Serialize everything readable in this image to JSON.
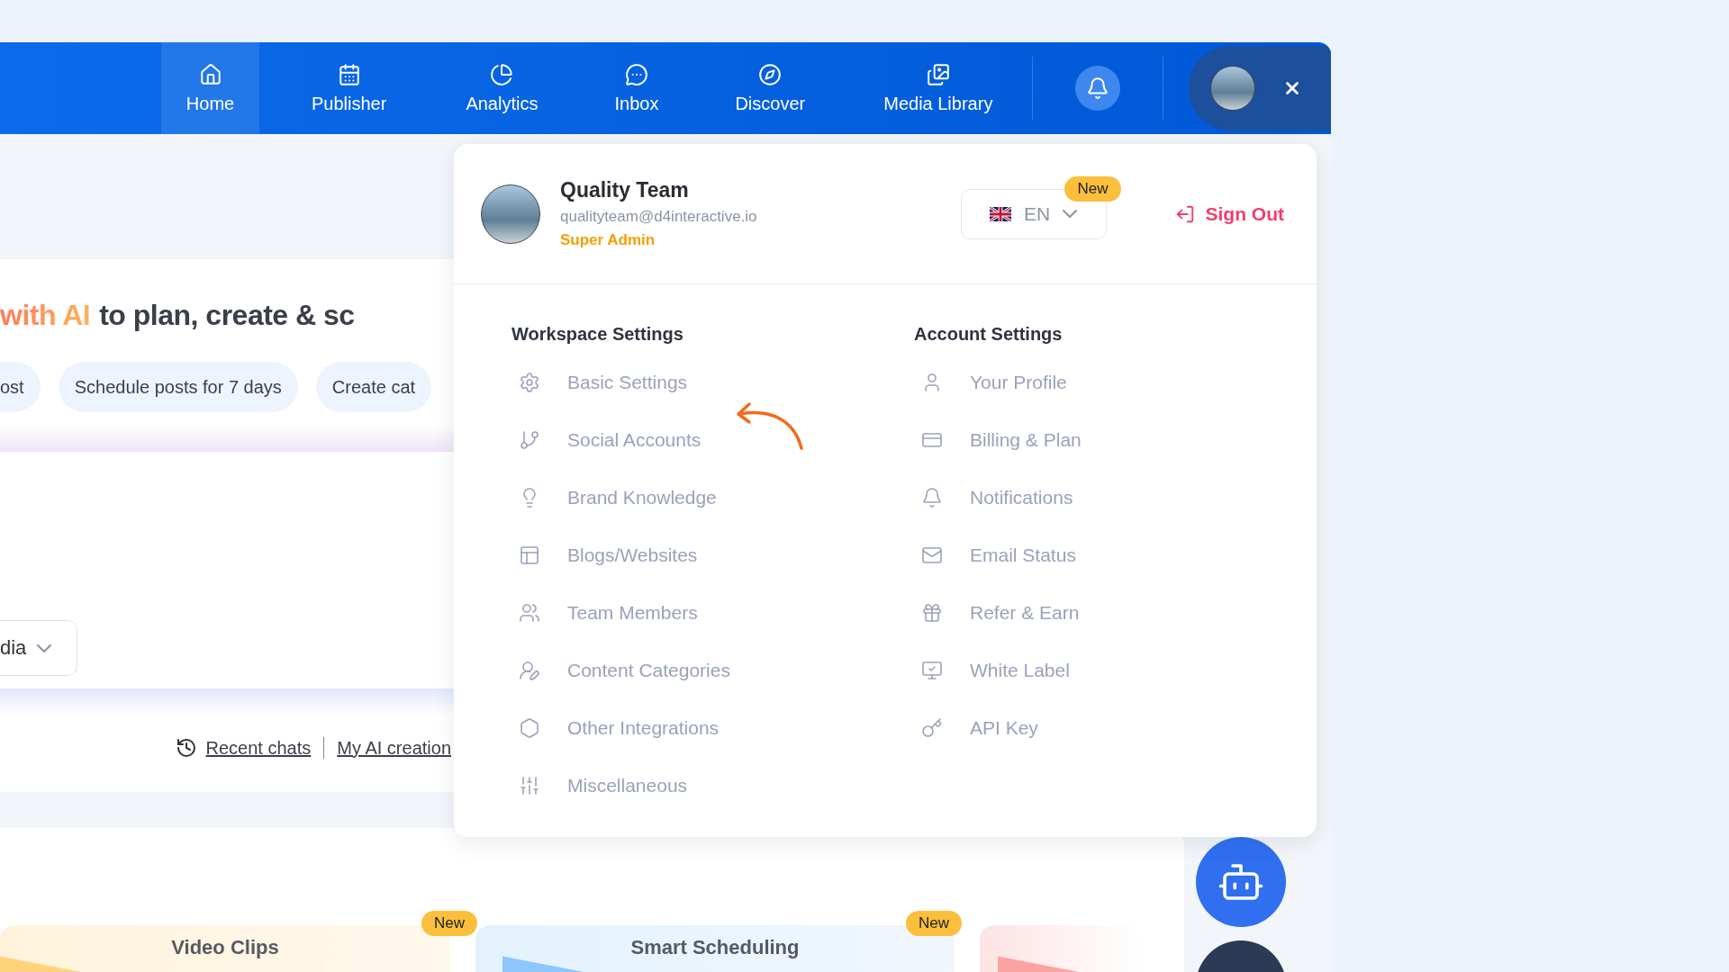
{
  "nav": {
    "items": [
      {
        "label": "Home",
        "selected": true
      },
      {
        "label": "Publisher",
        "selected": false
      },
      {
        "label": "Analytics",
        "selected": false
      },
      {
        "label": "Inbox",
        "selected": false
      },
      {
        "label": "Discover",
        "selected": false
      },
      {
        "label": "Media Library",
        "selected": false
      }
    ]
  },
  "hero": {
    "headline_highlight": "with AI",
    "headline": "to plan, create & sc",
    "chips": [
      "ost",
      "Schedule posts for 7 days",
      "Create cat"
    ],
    "select": "dia",
    "links": [
      "Recent chats",
      "My AI creation"
    ]
  },
  "feature_cards": [
    {
      "title": "Video Clips",
      "badge": "New"
    },
    {
      "title": "Smart Scheduling",
      "badge": "New"
    }
  ],
  "profile_menu": {
    "user": {
      "name": "Quality Team",
      "email": "qualityteam@d4interactive.io",
      "role": "Super Admin"
    },
    "language": {
      "code": "EN",
      "badge": "New"
    },
    "sign_out": "Sign Out",
    "sections": [
      {
        "title": "Workspace Settings",
        "items": [
          "Basic Settings",
          "Social Accounts",
          "Brand Knowledge",
          "Blogs/Websites",
          "Team Members",
          "Content Categories",
          "Other Integrations",
          "Miscellaneous"
        ]
      },
      {
        "title": "Account Settings",
        "items": [
          "Your Profile",
          "Billing & Plan",
          "Notifications",
          "Email Status",
          "Refer & Earn",
          "White Label",
          "API Key"
        ]
      }
    ]
  }
}
